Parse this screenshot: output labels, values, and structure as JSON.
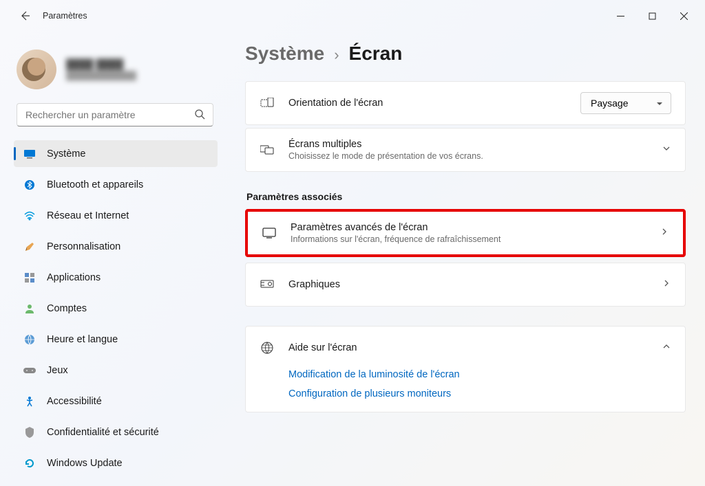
{
  "window": {
    "title": "Paramètres"
  },
  "user": {
    "name": "████ ████",
    "email": "████████████"
  },
  "search": {
    "placeholder": "Rechercher un paramètre"
  },
  "nav": {
    "items": [
      {
        "label": "Système"
      },
      {
        "label": "Bluetooth et appareils"
      },
      {
        "label": "Réseau et Internet"
      },
      {
        "label": "Personnalisation"
      },
      {
        "label": "Applications"
      },
      {
        "label": "Comptes"
      },
      {
        "label": "Heure et langue"
      },
      {
        "label": "Jeux"
      },
      {
        "label": "Accessibilité"
      },
      {
        "label": "Confidentialité et sécurité"
      },
      {
        "label": "Windows Update"
      }
    ]
  },
  "breadcrumb": {
    "parent": "Système",
    "sep": "›",
    "current": "Écran"
  },
  "rows": {
    "orientation": {
      "title": "Orientation de l'écran",
      "value": "Paysage"
    },
    "multiple": {
      "title": "Écrans multiples",
      "sub": "Choisissez le mode de présentation de vos écrans."
    },
    "section_label": "Paramètres associés",
    "advanced": {
      "title": "Paramètres avancés de l'écran",
      "sub": "Informations sur l'écran, fréquence de rafraîchissement"
    },
    "graphics": {
      "title": "Graphiques"
    },
    "help": {
      "title": "Aide sur l'écran",
      "links": [
        "Modification de la luminosité de l'écran",
        "Configuration de plusieurs moniteurs"
      ]
    }
  }
}
